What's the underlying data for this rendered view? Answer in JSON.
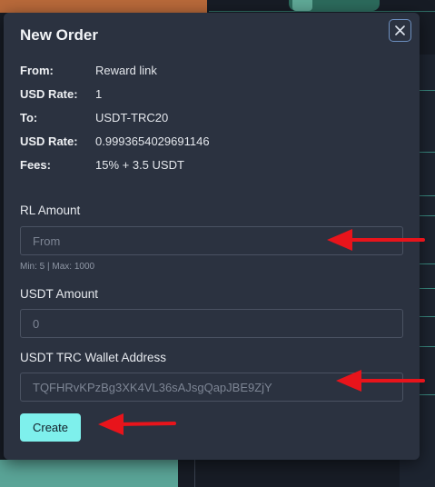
{
  "modal": {
    "title": "New Order",
    "info": [
      {
        "label": "From:",
        "value": "Reward link"
      },
      {
        "label": "USD Rate:",
        "value": "1"
      },
      {
        "label": "To:",
        "value": "USDT-TRC20"
      },
      {
        "label": "USD Rate:",
        "value": "0.9993654029691146"
      },
      {
        "label": "Fees:",
        "value": "15% + 3.5 USDT"
      }
    ],
    "rl_amount": {
      "label": "RL Amount",
      "placeholder": "From",
      "hint": "Min: 5 | Max: 1000"
    },
    "usdt_amount": {
      "label": "USDT Amount",
      "placeholder": "0"
    },
    "wallet": {
      "label": "USDT TRC Wallet Address",
      "placeholder": "TQFHRvKPzBg3XK4VL36sAJsgQapJBE9ZjY"
    },
    "create_label": "Create"
  },
  "colors": {
    "modal_bg": "#2b3240",
    "accent_button": "#7ef0ec",
    "close_border": "#6d8fbf",
    "annotation_arrow": "#e8141b"
  },
  "icons": {
    "close": "close-icon",
    "annotation": "red-arrow-icon"
  }
}
